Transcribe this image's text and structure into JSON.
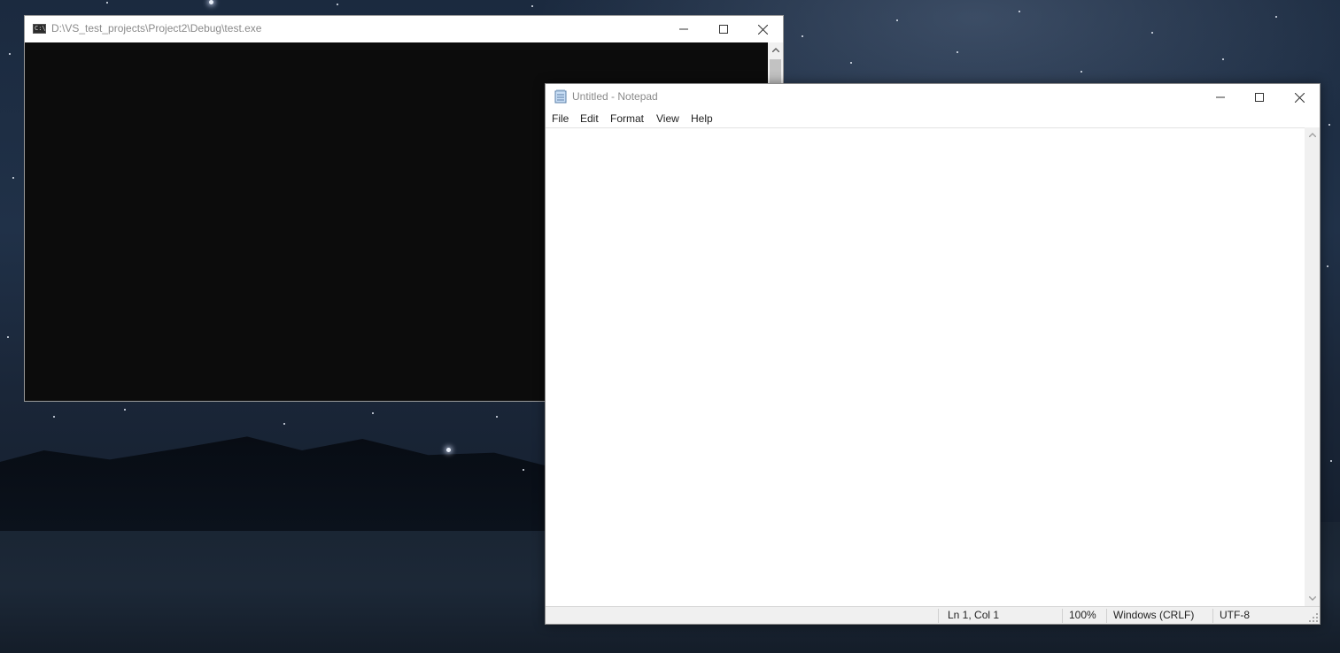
{
  "console_window": {
    "title": "D:\\VS_test_projects\\Project2\\Debug\\test.exe",
    "icon": "console-app-icon",
    "icon_text": "C:\\",
    "background_color": "#0c0c0c"
  },
  "notepad_window": {
    "title": "Untitled - Notepad",
    "icon": "notepad-icon",
    "menu": [
      {
        "label": "File"
      },
      {
        "label": "Edit"
      },
      {
        "label": "Format"
      },
      {
        "label": "View"
      },
      {
        "label": "Help"
      }
    ],
    "content": "",
    "status": {
      "position": "Ln 1, Col 1",
      "zoom": "100%",
      "line_ending": "Windows (CRLF)",
      "encoding": "UTF-8"
    }
  },
  "caption_buttons": {
    "minimize_icon": "minimize-icon",
    "maximize_icon": "maximize-icon",
    "close_icon": "close-icon"
  }
}
